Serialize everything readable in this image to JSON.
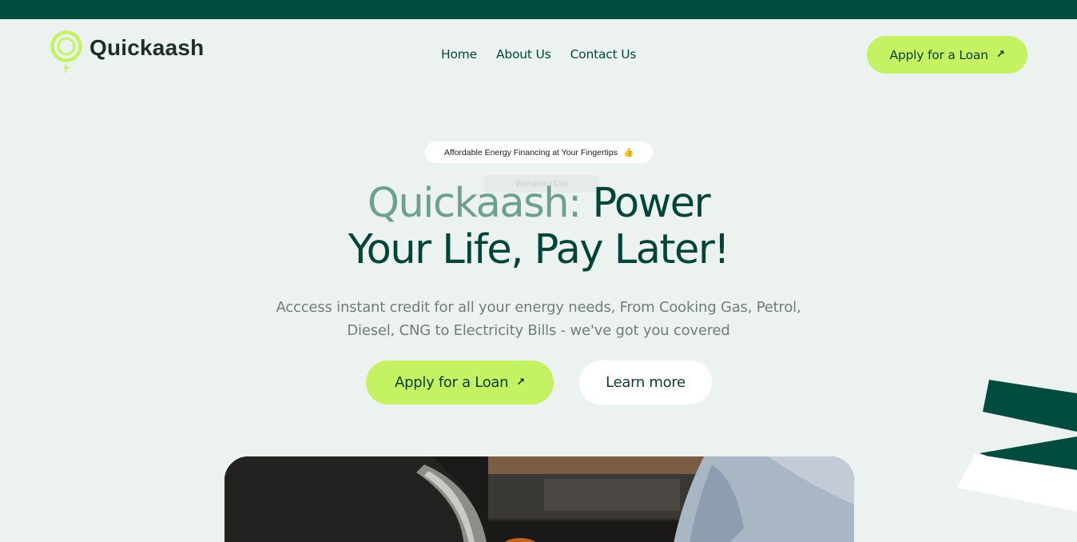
{
  "header": {
    "brand_name": "Quickaash",
    "nav": [
      "Home",
      "About Us",
      "Contact Us"
    ],
    "cta_label": "Apply for a Loan",
    "cta_icon": "arrow-up-right-icon"
  },
  "hero": {
    "badge_text": "Affordable Energy Financing at Your Fingertips",
    "badge_emoji": "👍",
    "ghost_text": "Wonderful Day",
    "title_brand": "Quickaash:",
    "title_rest_line1": "Power",
    "title_line2": "Your Life, Pay Later!",
    "subtitle": "Acccess instant credit for all your energy needs, From Cooking Gas, Petrol, Diesel, CNG to Electricity Bills - we've got you covered",
    "primary_button": "Apply for a Loan",
    "secondary_button": "Learn more"
  },
  "colors": {
    "top_bar": "#004d3f",
    "background": "#ecf2ef",
    "accent_lime": "#c4f263",
    "heading_dark": "#004538",
    "heading_brand": "#6ca08f"
  }
}
